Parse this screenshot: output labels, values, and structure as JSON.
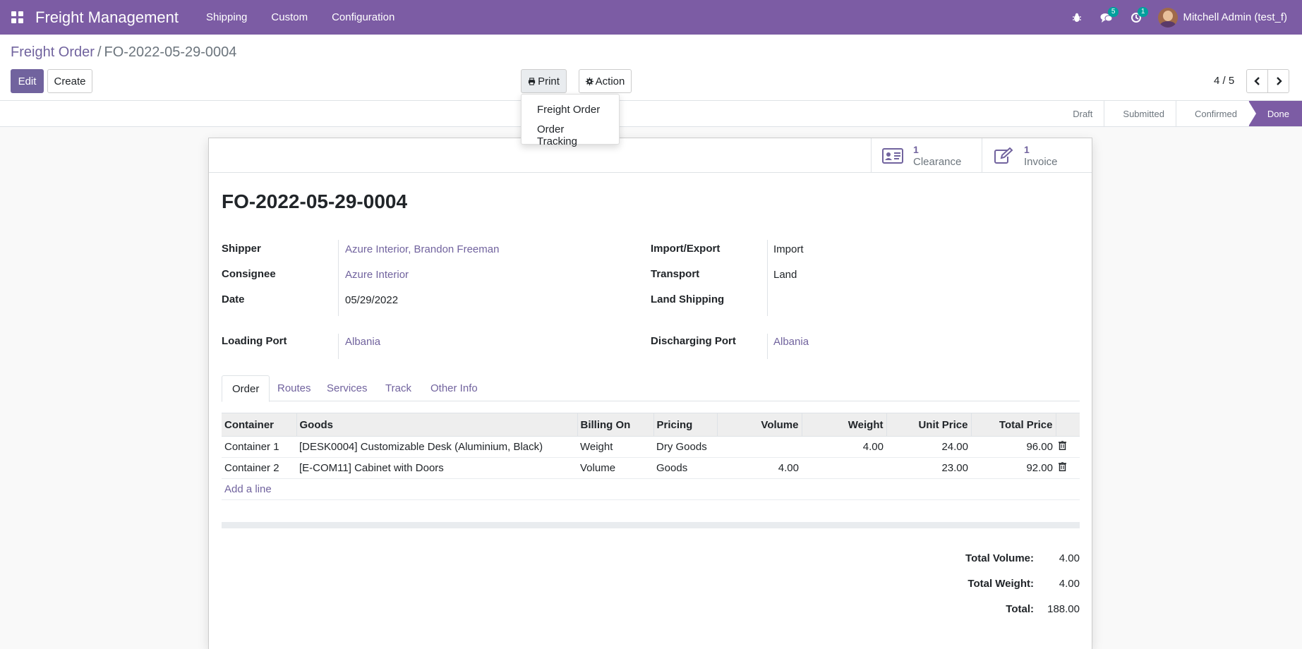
{
  "navbar": {
    "app_name": "Freight Management",
    "menu": [
      "Shipping",
      "Custom",
      "Configuration"
    ],
    "messages_count": "5",
    "activities_count": "1",
    "user": "Mitchell Admin (test_f)"
  },
  "breadcrumb": {
    "parent": "Freight Order",
    "separator": "/",
    "current": "FO-2022-05-29-0004"
  },
  "toolbar": {
    "edit_label": "Edit",
    "create_label": "Create",
    "print_label": "Print",
    "action_label": "Action",
    "pager_value": "4 / 5"
  },
  "print_menu": [
    "Freight Order",
    "Order Tracking"
  ],
  "status_stages": [
    "Draft",
    "Submitted",
    "Confirmed",
    "Done"
  ],
  "status_active": "Done",
  "smart_buttons": {
    "clearance": {
      "count": "1",
      "label": "Clearance"
    },
    "invoice": {
      "count": "1",
      "label": "Invoice"
    }
  },
  "record": {
    "title": "FO-2022-05-29-0004",
    "shipper_label": "Shipper",
    "shipper": "Azure Interior, Brandon Freeman",
    "consignee_label": "Consignee",
    "consignee": "Azure Interior",
    "date_label": "Date",
    "date": "05/29/2022",
    "import_export_label": "Import/Export",
    "import_export": "Import",
    "transport_label": "Transport",
    "transport": "Land",
    "land_shipping_label": "Land Shipping",
    "loading_port_label": "Loading Port",
    "loading_port": "Albania",
    "discharging_port_label": "Discharging Port",
    "discharging_port": "Albania"
  },
  "tabs": [
    "Order",
    "Routes",
    "Services",
    "Track",
    "Other Info"
  ],
  "order_table": {
    "columns": [
      "Container",
      "Goods",
      "Billing On",
      "Pricing",
      "Volume",
      "Weight",
      "Unit Price",
      "Total Price"
    ],
    "rows": [
      {
        "container": "Container 1",
        "goods": "[DESK0004] Customizable Desk (Aluminium, Black)",
        "billing_on": "Weight",
        "pricing": "Dry Goods",
        "volume": "",
        "weight": "4.00",
        "unit_price": "24.00",
        "total_price": "96.00"
      },
      {
        "container": "Container 2",
        "goods": "[E-COM11] Cabinet with Doors",
        "billing_on": "Volume",
        "pricing": "Goods",
        "volume": "4.00",
        "weight": "",
        "unit_price": "23.00",
        "total_price": "92.00"
      }
    ],
    "add_line": "Add a line"
  },
  "totals": {
    "volume_label": "Total Volume:",
    "volume": "4.00",
    "weight_label": "Total Weight:",
    "weight": "4.00",
    "total_label": "Total:",
    "total": "188.00"
  },
  "colors": {
    "brand": "#7c5ca4",
    "link": "#71639e",
    "badge": "#00a09d"
  }
}
